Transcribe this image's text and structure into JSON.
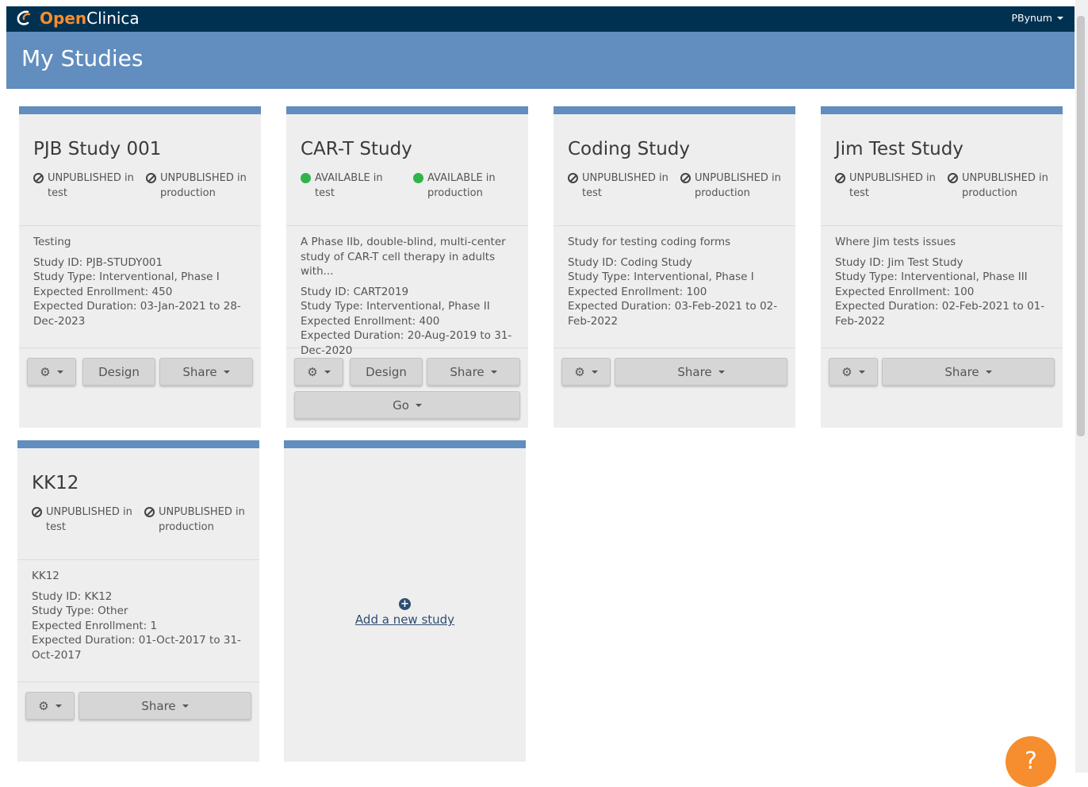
{
  "app": {
    "logo_part1": "Open",
    "logo_part2": "Clinica",
    "user": "PBynum"
  },
  "page": {
    "title": "My Studies"
  },
  "icons": {
    "settings": "gear-icon",
    "unpublished": "ban-icon",
    "available": "status-dot-icon",
    "add": "plus-circle-icon",
    "help": "question-icon"
  },
  "colors": {
    "accent": "#618dbf",
    "navbar": "#003150",
    "brand_orange": "#f68d2e",
    "available_green": "#2fb44a"
  },
  "studies": [
    {
      "title": "PJB Study 001",
      "status_test_label": "UNPUBLISHED in",
      "status_test_env": "test",
      "status_prod_label": "UNPUBLISHED in",
      "status_prod_env": "production",
      "description": "Testing",
      "study_id": "Study ID: PJB-STUDY001",
      "study_type": "Study Type: Interventional, Phase I",
      "enrollment": "Expected Enrollment: 450",
      "duration": "Expected Duration: 03-Jan-2021 to 28-Dec-2023",
      "design_label": "Design",
      "share_label": "Share"
    },
    {
      "title": "CAR-T Study",
      "status_test_label": "AVAILABLE in",
      "status_test_env": "test",
      "status_prod_label": "AVAILABLE in",
      "status_prod_env": "production",
      "description": "A Phase IIb, double-blind, multi-center study of CAR-T cell therapy in adults with...",
      "study_id": "Study ID: CART2019",
      "study_type": "Study Type: Interventional, Phase II",
      "enrollment": "Expected Enrollment: 400",
      "duration": "Expected Duration: 20-Aug-2019 to 31-Dec-2020",
      "design_label": "Design",
      "share_label": "Share",
      "go_label": "Go"
    },
    {
      "title": "Coding Study",
      "status_test_label": "UNPUBLISHED in",
      "status_test_env": "test",
      "status_prod_label": "UNPUBLISHED in",
      "status_prod_env": "production",
      "description": "Study for testing coding forms",
      "study_id": "Study ID: Coding Study",
      "study_type": "Study Type: Interventional, Phase I",
      "enrollment": "Expected Enrollment: 100",
      "duration": "Expected Duration: 03-Feb-2021 to 02-Feb-2022",
      "share_label": "Share"
    },
    {
      "title": "Jim Test Study",
      "status_test_label": "UNPUBLISHED in",
      "status_test_env": "test",
      "status_prod_label": "UNPUBLISHED in",
      "status_prod_env": "production",
      "description": "Where Jim tests issues",
      "study_id": "Study ID: Jim Test Study",
      "study_type": "Study Type: Interventional, Phase III",
      "enrollment": "Expected Enrollment: 100",
      "duration": "Expected Duration: 02-Feb-2021 to 01-Feb-2022",
      "share_label": "Share"
    },
    {
      "title": "KK12",
      "status_test_label": "UNPUBLISHED in",
      "status_test_env": "test",
      "status_prod_label": "UNPUBLISHED in",
      "status_prod_env": "production",
      "description": "KK12",
      "study_id": "Study ID: KK12",
      "study_type": "Study Type: Other",
      "enrollment": "Expected Enrollment: 1",
      "duration": "Expected Duration: 01-Oct-2017 to 31-Oct-2017",
      "share_label": "Share"
    }
  ],
  "add_study": {
    "label": "Add a new study"
  },
  "help": {
    "label": "?"
  }
}
